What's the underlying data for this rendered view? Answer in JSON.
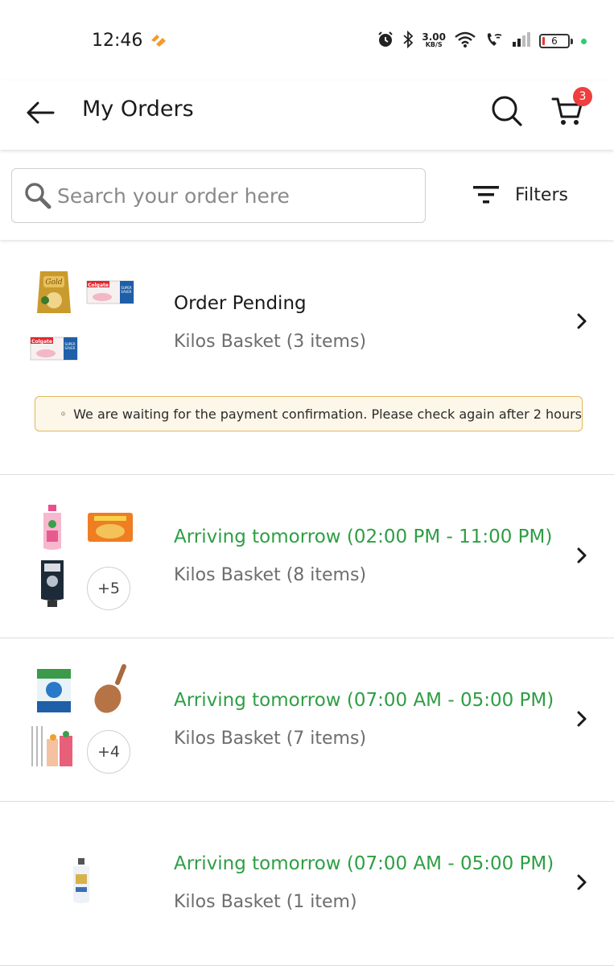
{
  "status_bar": {
    "time": "12:46",
    "net_speed_value": "3.00",
    "net_speed_unit": "KB/S",
    "battery_level": "6"
  },
  "header": {
    "title": "My Orders",
    "cart_count": "3"
  },
  "search": {
    "placeholder": "Search your order here",
    "value": ""
  },
  "filters": {
    "label": "Filters"
  },
  "orders": [
    {
      "status": "Order Pending",
      "status_type": "pending",
      "store_line": "Kilos Basket (3 items)",
      "notice": "We are waiting for the payment confirmation. Please check again after 2 hours",
      "thumbnails": [
        "tea-pack",
        "toothpaste-box",
        "toothpaste-box"
      ]
    },
    {
      "status": "Arriving tomorrow (02:00 PM - 11:00 PM)",
      "status_type": "arriving",
      "store_line": "Kilos Basket (8 items)",
      "more_count": "+5",
      "thumbnails": [
        "bodywash-bottle",
        "biscuit-pack",
        "facewash-tube"
      ]
    },
    {
      "status": "Arriving tomorrow (07:00 AM - 05:00 PM)",
      "status_type": "arriving",
      "store_line": "Kilos Basket (7 items)",
      "more_count": "+4",
      "thumbnails": [
        "detergent-pack",
        "wooden-spoon",
        "straws-glasses"
      ]
    },
    {
      "status": "Arriving tomorrow (07:00 AM - 05:00 PM)",
      "status_type": "arriving",
      "store_line": "Kilos Basket (1 item)",
      "thumbnails": [
        "shampoo-bottle"
      ]
    }
  ],
  "colors": {
    "arriving_green": "#2e9e44",
    "badge_red": "#ef3e3e",
    "notice_border": "#e2b65a",
    "notice_bg": "#fdf7e9"
  }
}
